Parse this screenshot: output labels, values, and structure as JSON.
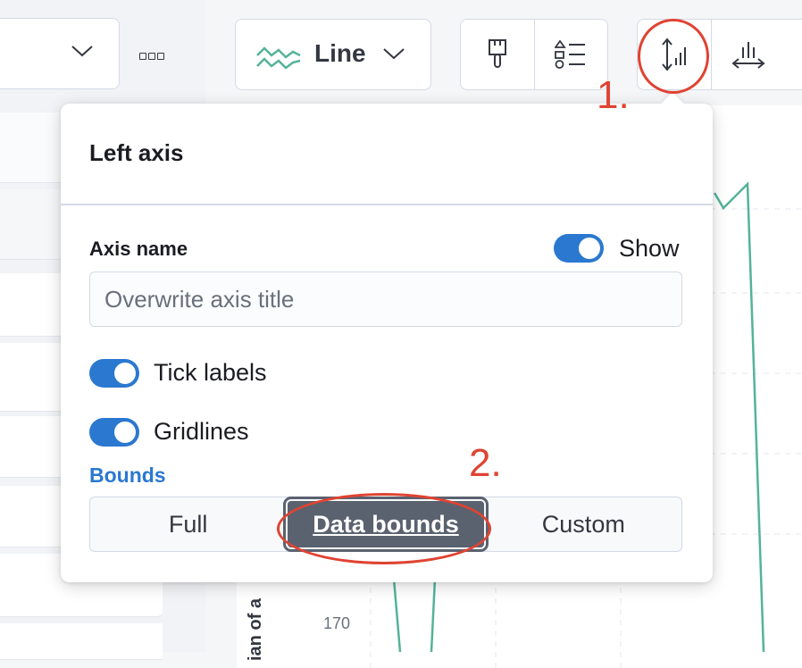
{
  "toolbar": {
    "chart_type_label": "Line",
    "more_label": "more options",
    "active_button": "left-axis"
  },
  "popover": {
    "title": "Left axis",
    "axis_name_label": "Axis name",
    "show_label": "Show",
    "show_enabled": true,
    "axis_input_placeholder": "Overwrite axis title",
    "axis_input_value": "",
    "tick_labels_label": "Tick labels",
    "tick_labels_enabled": true,
    "gridlines_label": "Gridlines",
    "gridlines_enabled": true,
    "bounds_label": "Bounds",
    "bounds_options": [
      "Full",
      "Data bounds",
      "Custom"
    ],
    "bounds_selected": "Data bounds"
  },
  "background_chart": {
    "axis_title_fragment": "ian of a",
    "tick_value": "170"
  },
  "annotations": {
    "step1": "1.",
    "step2": "2."
  },
  "colors": {
    "accent": "#2b78d0",
    "annotation": "#e04332",
    "line_series": "#54b399",
    "selected_button": "#5a6270"
  }
}
